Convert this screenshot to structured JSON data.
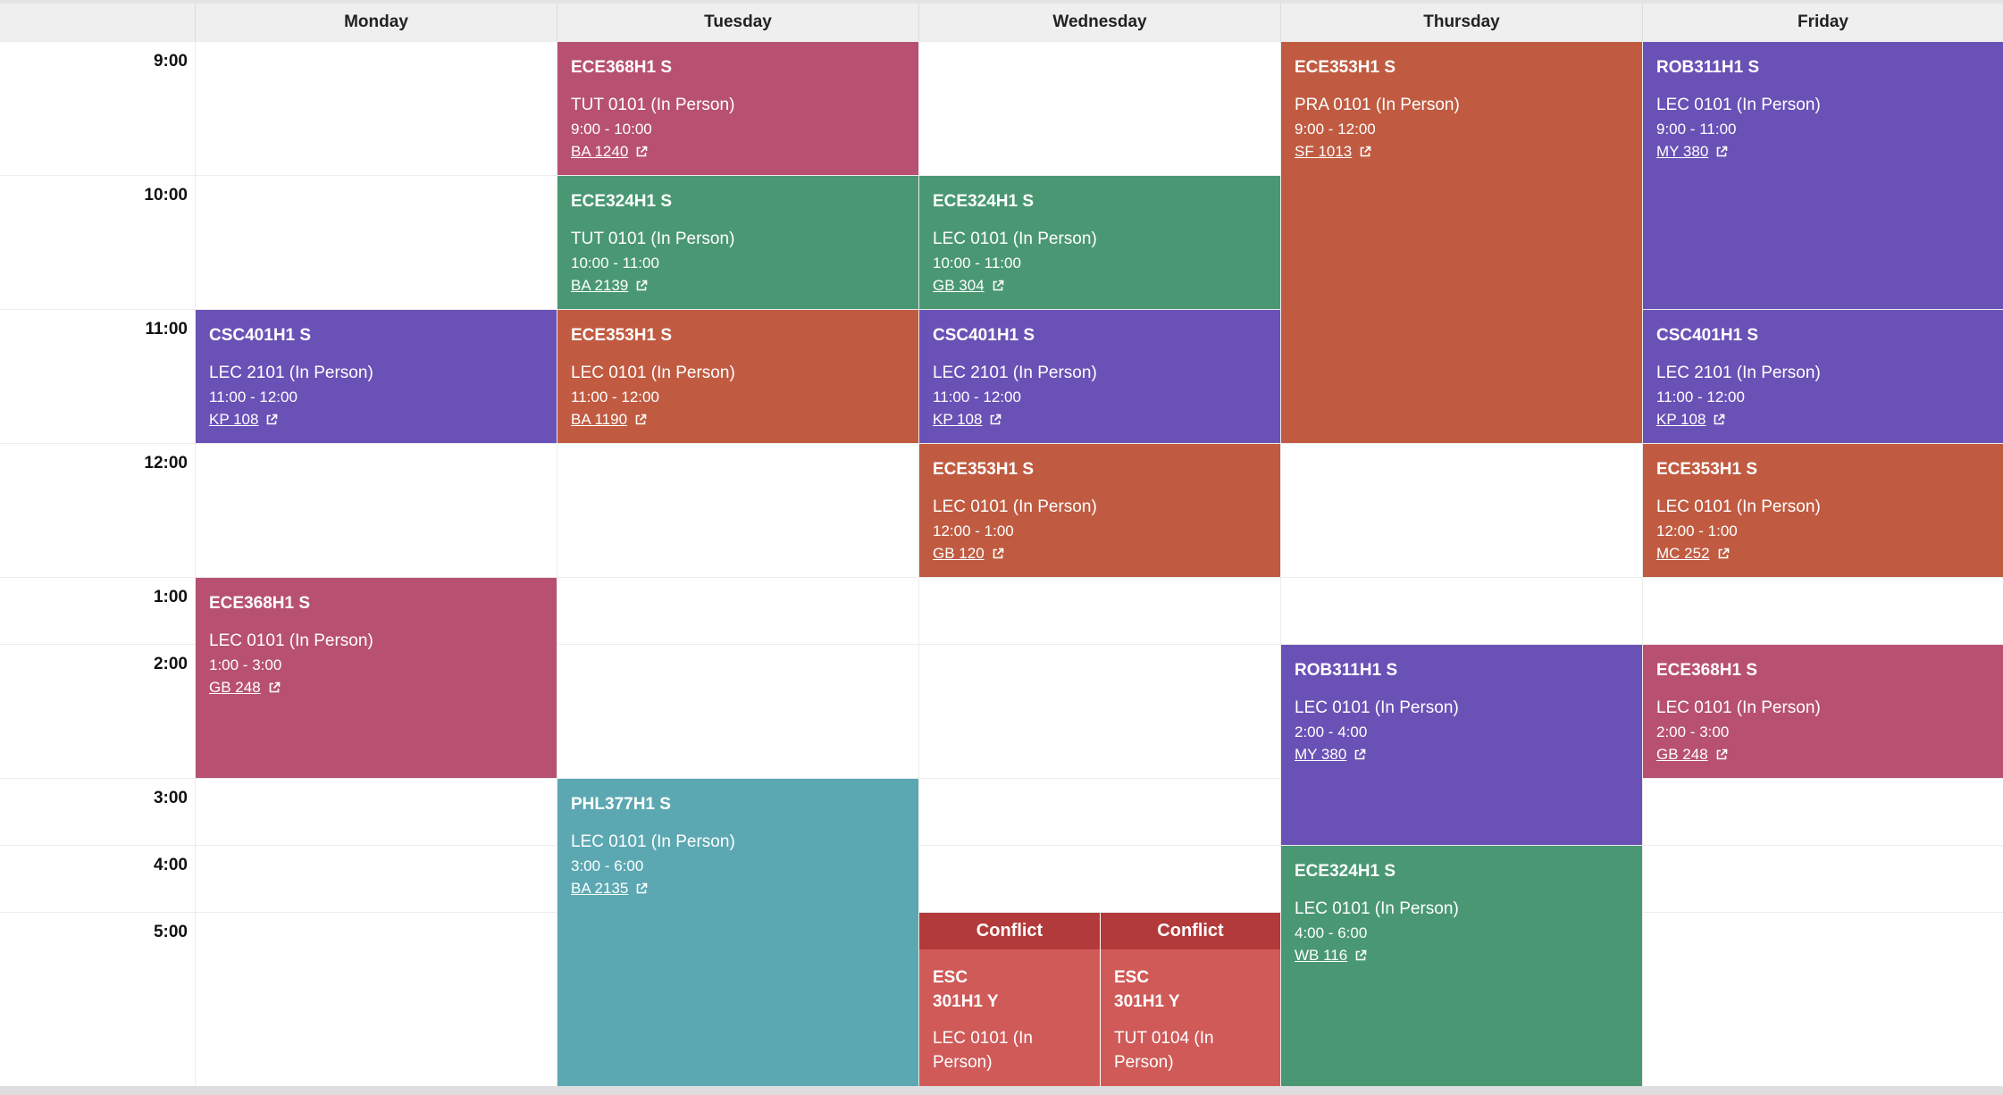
{
  "days": [
    "Monday",
    "Tuesday",
    "Wednesday",
    "Thursday",
    "Friday"
  ],
  "hours": [
    "9:00",
    "10:00",
    "11:00",
    "12:00",
    "1:00",
    "2:00",
    "3:00",
    "4:00",
    "5:00"
  ],
  "colors": {
    "ECE368H1 S": "#b85171",
    "ECE324H1 S": "#4a9873",
    "ECE353H1 S": "#c05b41",
    "CSC401H1 S": "#6a51b6",
    "ROB311H1 S": "#6a51b6",
    "PHL377H1 S": "#5ca8b2",
    "conflict_header": "#b23a3a",
    "conflict_body": "#cf5a58"
  },
  "events": [
    {
      "day": 1,
      "code": "ECE368H1 S",
      "section": "TUT 0101 (In Person)",
      "time": "9:00 - 10:00",
      "room": "BA 1240",
      "start": 0,
      "end": 1
    },
    {
      "day": 1,
      "code": "ECE324H1 S",
      "section": "TUT 0101 (In Person)",
      "time": "10:00 - 11:00",
      "room": "BA 2139",
      "start": 1,
      "end": 2
    },
    {
      "day": 1,
      "code": "ECE353H1 S",
      "section": "LEC 0101 (In Person)",
      "time": "11:00 - 12:00",
      "room": "BA 1190",
      "start": 2,
      "end": 3
    },
    {
      "day": 1,
      "code": "PHL377H1 S",
      "section": "LEC 0101 (In Person)",
      "time": "3:00 - 6:00",
      "room": "BA 2135",
      "start": 6,
      "end": 9
    },
    {
      "day": 2,
      "code": "ECE324H1 S",
      "section": "LEC 0101 (In Person)",
      "time": "10:00 - 11:00",
      "room": "GB 304",
      "start": 1,
      "end": 2
    },
    {
      "day": 2,
      "code": "CSC401H1 S",
      "section": "LEC 2101 (In Person)",
      "time": "11:00 - 12:00",
      "room": "KP 108",
      "start": 2,
      "end": 3
    },
    {
      "day": 2,
      "code": "ECE353H1 S",
      "section": "LEC 0101 (In Person)",
      "time": "12:00 - 1:00",
      "room": "GB 120",
      "start": 3,
      "end": 4
    },
    {
      "day": 3,
      "code": "ECE353H1 S",
      "section": "PRA 0101 (In Person)",
      "time": "9:00 - 12:00",
      "room": "SF 1013",
      "start": 0,
      "end": 3
    },
    {
      "day": 3,
      "code": "ROB311H1 S",
      "section": "LEC 0101 (In Person)",
      "time": "2:00 - 4:00",
      "room": "MY 380",
      "start": 5,
      "end": 7
    },
    {
      "day": 3,
      "code": "ECE324H1 S",
      "section": "LEC 0101 (In Person)",
      "time": "4:00 - 6:00",
      "room": "WB 116",
      "start": 7,
      "end": 9
    },
    {
      "day": 4,
      "code": "ROB311H1 S",
      "section": "LEC 0101 (In Person)",
      "time": "9:00 - 11:00",
      "room": "MY 380",
      "start": 0,
      "end": 2
    },
    {
      "day": 4,
      "code": "CSC401H1 S",
      "section": "LEC 2101 (In Person)",
      "time": "11:00 - 12:00",
      "room": "KP 108",
      "start": 2,
      "end": 3
    },
    {
      "day": 4,
      "code": "ECE353H1 S",
      "section": "LEC 0101 (In Person)",
      "time": "12:00 - 1:00",
      "room": "MC 252",
      "start": 3,
      "end": 4
    },
    {
      "day": 4,
      "code": "ECE368H1 S",
      "section": "LEC 0101 (In Person)",
      "time": "2:00 - 3:00",
      "room": "GB 248",
      "start": 5,
      "end": 6
    },
    {
      "day": 0,
      "code": "CSC401H1 S",
      "section": "LEC 2101 (In Person)",
      "time": "11:00 - 12:00",
      "room": "KP 108",
      "start": 2,
      "end": 3
    },
    {
      "day": 0,
      "code": "ECE368H1 S",
      "section": "LEC 0101 (In Person)",
      "time": "1:00 - 3:00",
      "room": "GB 248",
      "start": 4,
      "end": 6
    }
  ],
  "conflicts": [
    {
      "day": 2,
      "half": 0,
      "label": "Conflict",
      "code_line1": "ESC",
      "code_line2": "301H1 Y",
      "section_line1": "LEC 0101 (In",
      "section_line2": "Person)"
    },
    {
      "day": 2,
      "half": 1,
      "label": "Conflict",
      "code_line1": "ESC",
      "code_line2": "301H1 Y",
      "section_line1": "TUT 0104 (In",
      "section_line2": "Person)"
    }
  ]
}
